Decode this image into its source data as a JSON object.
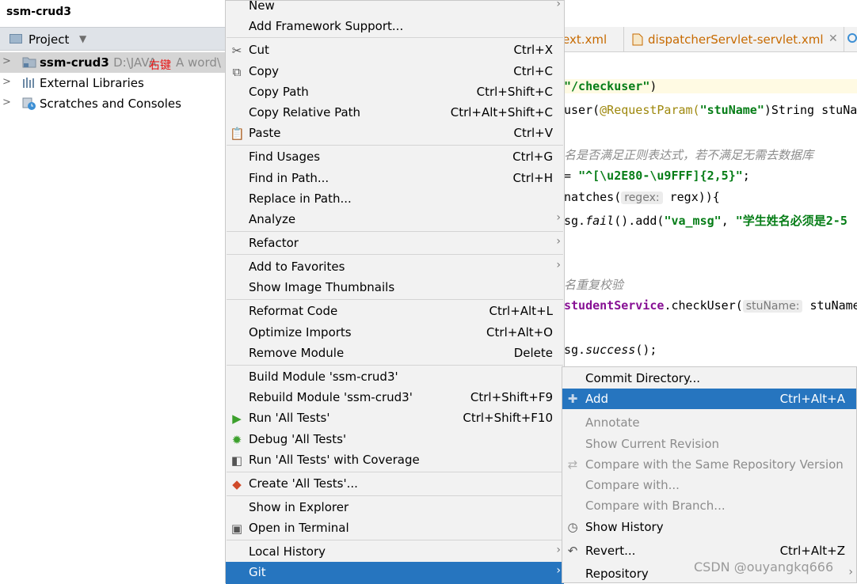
{
  "project_panel": {
    "title": "ssm-crud3",
    "header_label": "Project",
    "tree": [
      {
        "name": "ssm-crud3",
        "path": "D:\\JAVA",
        "path_tail": "A word\\",
        "overlay": "右键"
      },
      {
        "name": "External Libraries"
      },
      {
        "name": "Scratches and Consoles"
      }
    ]
  },
  "editor": {
    "tabs": [
      {
        "label": "ext.xml"
      },
      {
        "label": "dispatcherServlet-servlet.xml"
      }
    ],
    "lines": {
      "l1_str": "\"/checkuser\"",
      "l1_close": ")",
      "l2_a": "user(",
      "l2_ann": "@RequestParam(",
      "l2_str": "\"stuName\"",
      "l2_b": ")String stuNam",
      "l3_comment": "名是否满足正则表达式，若不满足无需去数据库",
      "l4_a": "= ",
      "l4_str": "\"^[\\u2E80-\\u9FFF]{2,5}\"",
      "l4_b": ";",
      "l5_a": "natches(",
      "l5_hint": "regex:",
      "l5_b": " regx)){",
      "l6_a": "sg.",
      "l6_fail": "fail",
      "l6_b": "().add(",
      "l6_str1": "\"va_msg\"",
      "l6_c": ", ",
      "l6_str2": "\"学生姓名必须是2-5",
      "l7_comment": "名重复校验",
      "l8_field": "studentService",
      "l8_a": ".checkUser(",
      "l8_hint": "stuName:",
      "l8_b": " stuName",
      "l9_a": "sg.",
      "l9_success": "success",
      "l9_b": "();"
    }
  },
  "context_menu": {
    "items": [
      {
        "label": "New",
        "shortcut": "",
        "submenu": true
      },
      {
        "label": "Add Framework Support...",
        "shortcut": ""
      },
      {
        "label": "Cut",
        "shortcut": "Ctrl+X",
        "icon": "scissors-icon"
      },
      {
        "label": "Copy",
        "shortcut": "Ctrl+C",
        "icon": "copy-icon"
      },
      {
        "label": "Copy Path",
        "shortcut": "Ctrl+Shift+C"
      },
      {
        "label": "Copy Relative Path",
        "shortcut": "Ctrl+Alt+Shift+C"
      },
      {
        "label": "Paste",
        "shortcut": "Ctrl+V",
        "icon": "paste-icon"
      },
      {
        "label": "Find Usages",
        "shortcut": "Ctrl+G"
      },
      {
        "label": "Find in Path...",
        "shortcut": "Ctrl+H"
      },
      {
        "label": "Replace in Path...",
        "shortcut": ""
      },
      {
        "label": "Analyze",
        "shortcut": "",
        "submenu": true
      },
      {
        "label": "Refactor",
        "shortcut": "",
        "submenu": true
      },
      {
        "label": "Add to Favorites",
        "shortcut": "",
        "submenu": true
      },
      {
        "label": "Show Image Thumbnails",
        "shortcut": ""
      },
      {
        "label": "Reformat Code",
        "shortcut": "Ctrl+Alt+L"
      },
      {
        "label": "Optimize Imports",
        "shortcut": "Ctrl+Alt+O"
      },
      {
        "label": "Remove Module",
        "shortcut": "Delete"
      },
      {
        "label": "Build Module 'ssm-crud3'",
        "shortcut": ""
      },
      {
        "label": "Rebuild Module 'ssm-crud3'",
        "shortcut": "Ctrl+Shift+F9"
      },
      {
        "label": "Run 'All Tests'",
        "shortcut": "Ctrl+Shift+F10",
        "icon": "run-icon"
      },
      {
        "label": "Debug 'All Tests'",
        "shortcut": "",
        "icon": "debug-icon"
      },
      {
        "label": "Run 'All Tests' with Coverage",
        "shortcut": "",
        "icon": "coverage-icon"
      },
      {
        "label": "Create 'All Tests'...",
        "shortcut": "",
        "icon": "create-test-icon"
      },
      {
        "label": "Show in Explorer",
        "shortcut": ""
      },
      {
        "label": "Open in Terminal",
        "shortcut": "",
        "icon": "terminal-icon"
      },
      {
        "label": "Local History",
        "shortcut": "",
        "submenu": true
      },
      {
        "label": "Git",
        "shortcut": "",
        "submenu": true,
        "selected": true
      }
    ]
  },
  "git_submenu": {
    "items": [
      {
        "label": "Commit Directory...",
        "shortcut": ""
      },
      {
        "label": "Add",
        "shortcut": "Ctrl+Alt+A",
        "selected": true,
        "icon": "plus-icon"
      },
      {
        "label": "Annotate",
        "shortcut": "",
        "disabled": true
      },
      {
        "label": "Show Current Revision",
        "shortcut": "",
        "disabled": true
      },
      {
        "label": "Compare with the Same Repository Version",
        "shortcut": "",
        "disabled": true,
        "icon": "compare-icon"
      },
      {
        "label": "Compare with...",
        "shortcut": "",
        "disabled": true
      },
      {
        "label": "Compare with Branch...",
        "shortcut": "",
        "disabled": true
      },
      {
        "label": "Show History",
        "shortcut": "",
        "icon": "clock-icon"
      },
      {
        "label": "Revert...",
        "shortcut": "Ctrl+Alt+Z",
        "icon": "revert-icon"
      },
      {
        "label": "Repository",
        "shortcut": "",
        "submenu": true
      }
    ]
  },
  "watermark": "CSDN @ouyangkq666"
}
